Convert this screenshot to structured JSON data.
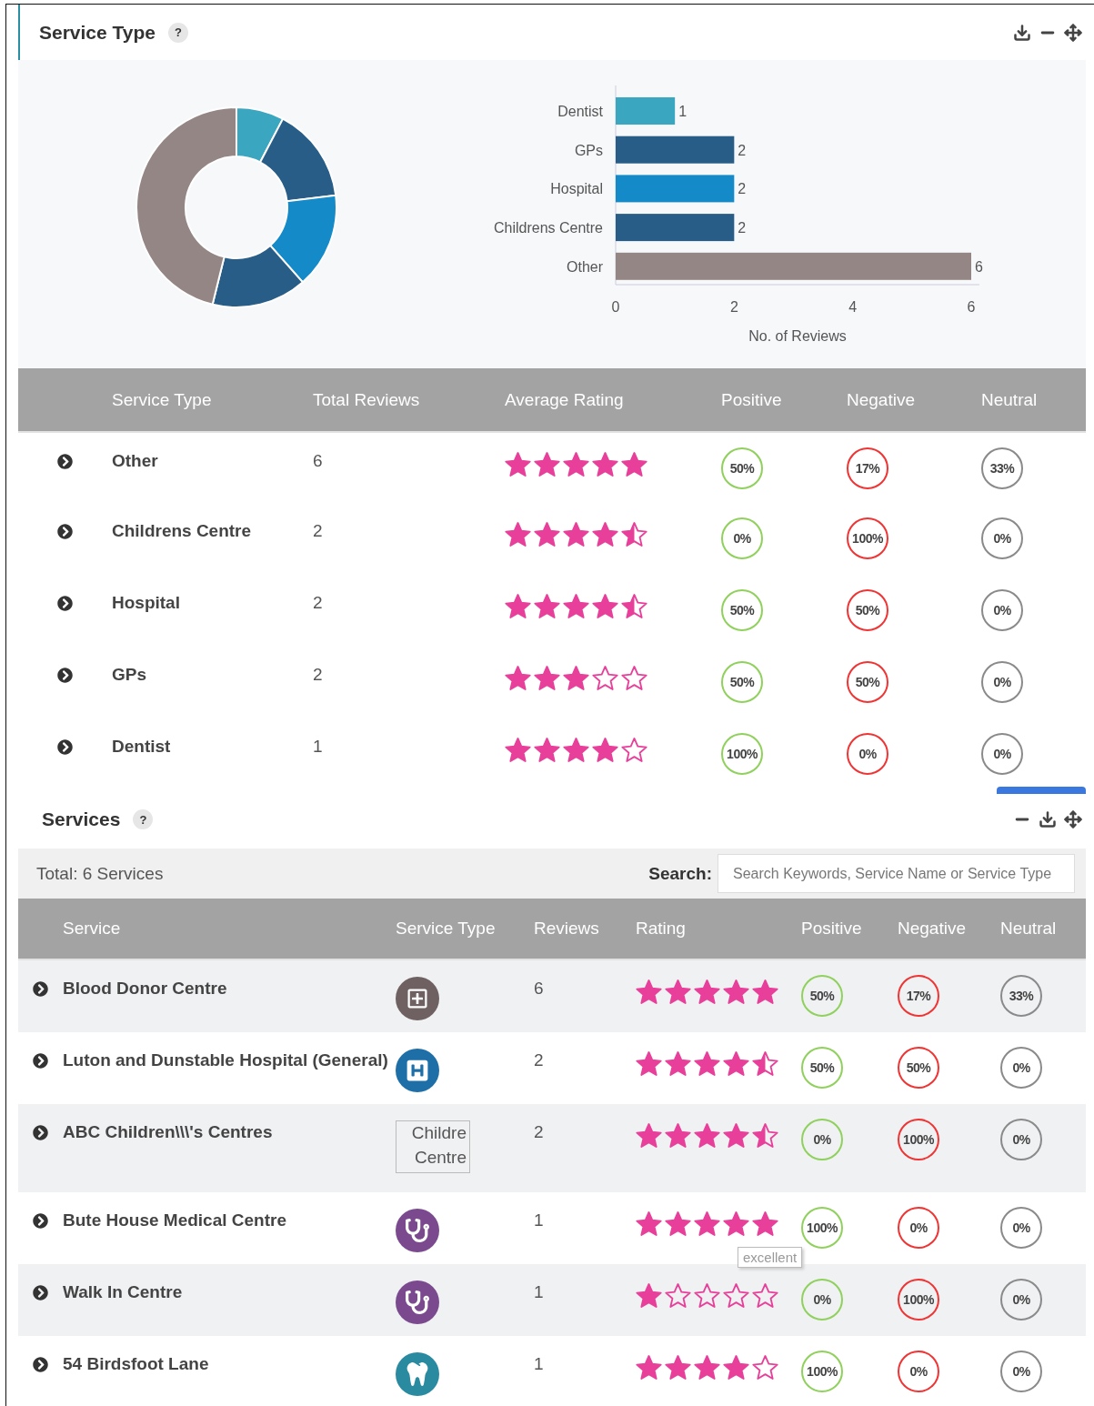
{
  "service_type_panel": {
    "title": "Service Type",
    "help": "?",
    "chart_data": {
      "type": "bar",
      "orientation": "horizontal",
      "xlabel": "No. of Reviews",
      "categories": [
        "Dentist",
        "GPs",
        "Hospital",
        "Childrens Centre",
        "Other"
      ],
      "series": [
        {
          "color": "#3aa6bf",
          "values": [
            1,
            null,
            null,
            null,
            null
          ]
        },
        {
          "color": "#285d87",
          "values": [
            null,
            2,
            null,
            2,
            null
          ]
        },
        {
          "color": "#148ac8",
          "values": [
            null,
            null,
            2,
            null,
            null
          ]
        },
        {
          "color": "#948685",
          "values": [
            null,
            null,
            null,
            null,
            6
          ]
        }
      ],
      "xlim": [
        0,
        6
      ],
      "xticks": [
        0,
        2,
        4,
        6
      ],
      "data_labels": true
    },
    "table": {
      "columns": [
        "Service Type",
        "Total Reviews",
        "Average Rating",
        "Positive",
        "Negative",
        "Neutral"
      ],
      "rows": [
        {
          "name": "Other",
          "total": "6",
          "stars": 5,
          "positive": "50%",
          "negative": "17%",
          "neutral": "33%"
        },
        {
          "name": "Childrens Centre",
          "total": "2",
          "stars": 4.5,
          "positive": "0%",
          "negative": "100%",
          "neutral": "0%"
        },
        {
          "name": "Hospital",
          "total": "2",
          "stars": 4.5,
          "positive": "50%",
          "negative": "50%",
          "neutral": "0%"
        },
        {
          "name": "GPs",
          "total": "2",
          "stars": 3,
          "positive": "50%",
          "negative": "50%",
          "neutral": "0%"
        },
        {
          "name": "Dentist",
          "total": "1",
          "stars": 4,
          "positive": "100%",
          "negative": "0%",
          "neutral": "0%"
        }
      ]
    }
  },
  "services_panel": {
    "title": "Services",
    "help": "?",
    "total": "Total: 6 Services",
    "search_label": "Search:",
    "search_placeholder": "Search Keywords, Service Name or Service Type",
    "table": {
      "columns": [
        "Service",
        "Service Type",
        "Reviews",
        "Rating",
        "Positive",
        "Negative",
        "Neutral"
      ],
      "rows": [
        {
          "name": "Blood Donor Centre",
          "kind": "plus",
          "reviews": "6",
          "stars": 5,
          "positive": "50%",
          "negative": "17%",
          "neutral": "33%"
        },
        {
          "name": "Luton and Dunstable Hospital (General)",
          "kind": "hospital",
          "reviews": "2",
          "stars": 4.5,
          "positive": "50%",
          "negative": "50%",
          "neutral": "0%"
        },
        {
          "name": "ABC Children\\\\\\'s Centres",
          "kind": "broken-image",
          "icon_alt": "Childre Centre",
          "reviews": "2",
          "stars": 4.5,
          "positive": "0%",
          "negative": "100%",
          "neutral": "0%"
        },
        {
          "name": "Bute House Medical Centre",
          "kind": "stethoscope",
          "reviews": "1",
          "stars": 5,
          "positive": "100%",
          "negative": "0%",
          "neutral": "0%",
          "tooltip": "excellent"
        },
        {
          "name": "Walk In Centre",
          "kind": "stethoscope",
          "reviews": "1",
          "stars": 1,
          "positive": "0%",
          "negative": "100%",
          "neutral": "0%"
        },
        {
          "name": "54 Birdsfoot Lane",
          "kind": "tooth",
          "reviews": "1",
          "stars": 4,
          "positive": "100%",
          "negative": "0%",
          "neutral": "0%"
        }
      ]
    }
  }
}
